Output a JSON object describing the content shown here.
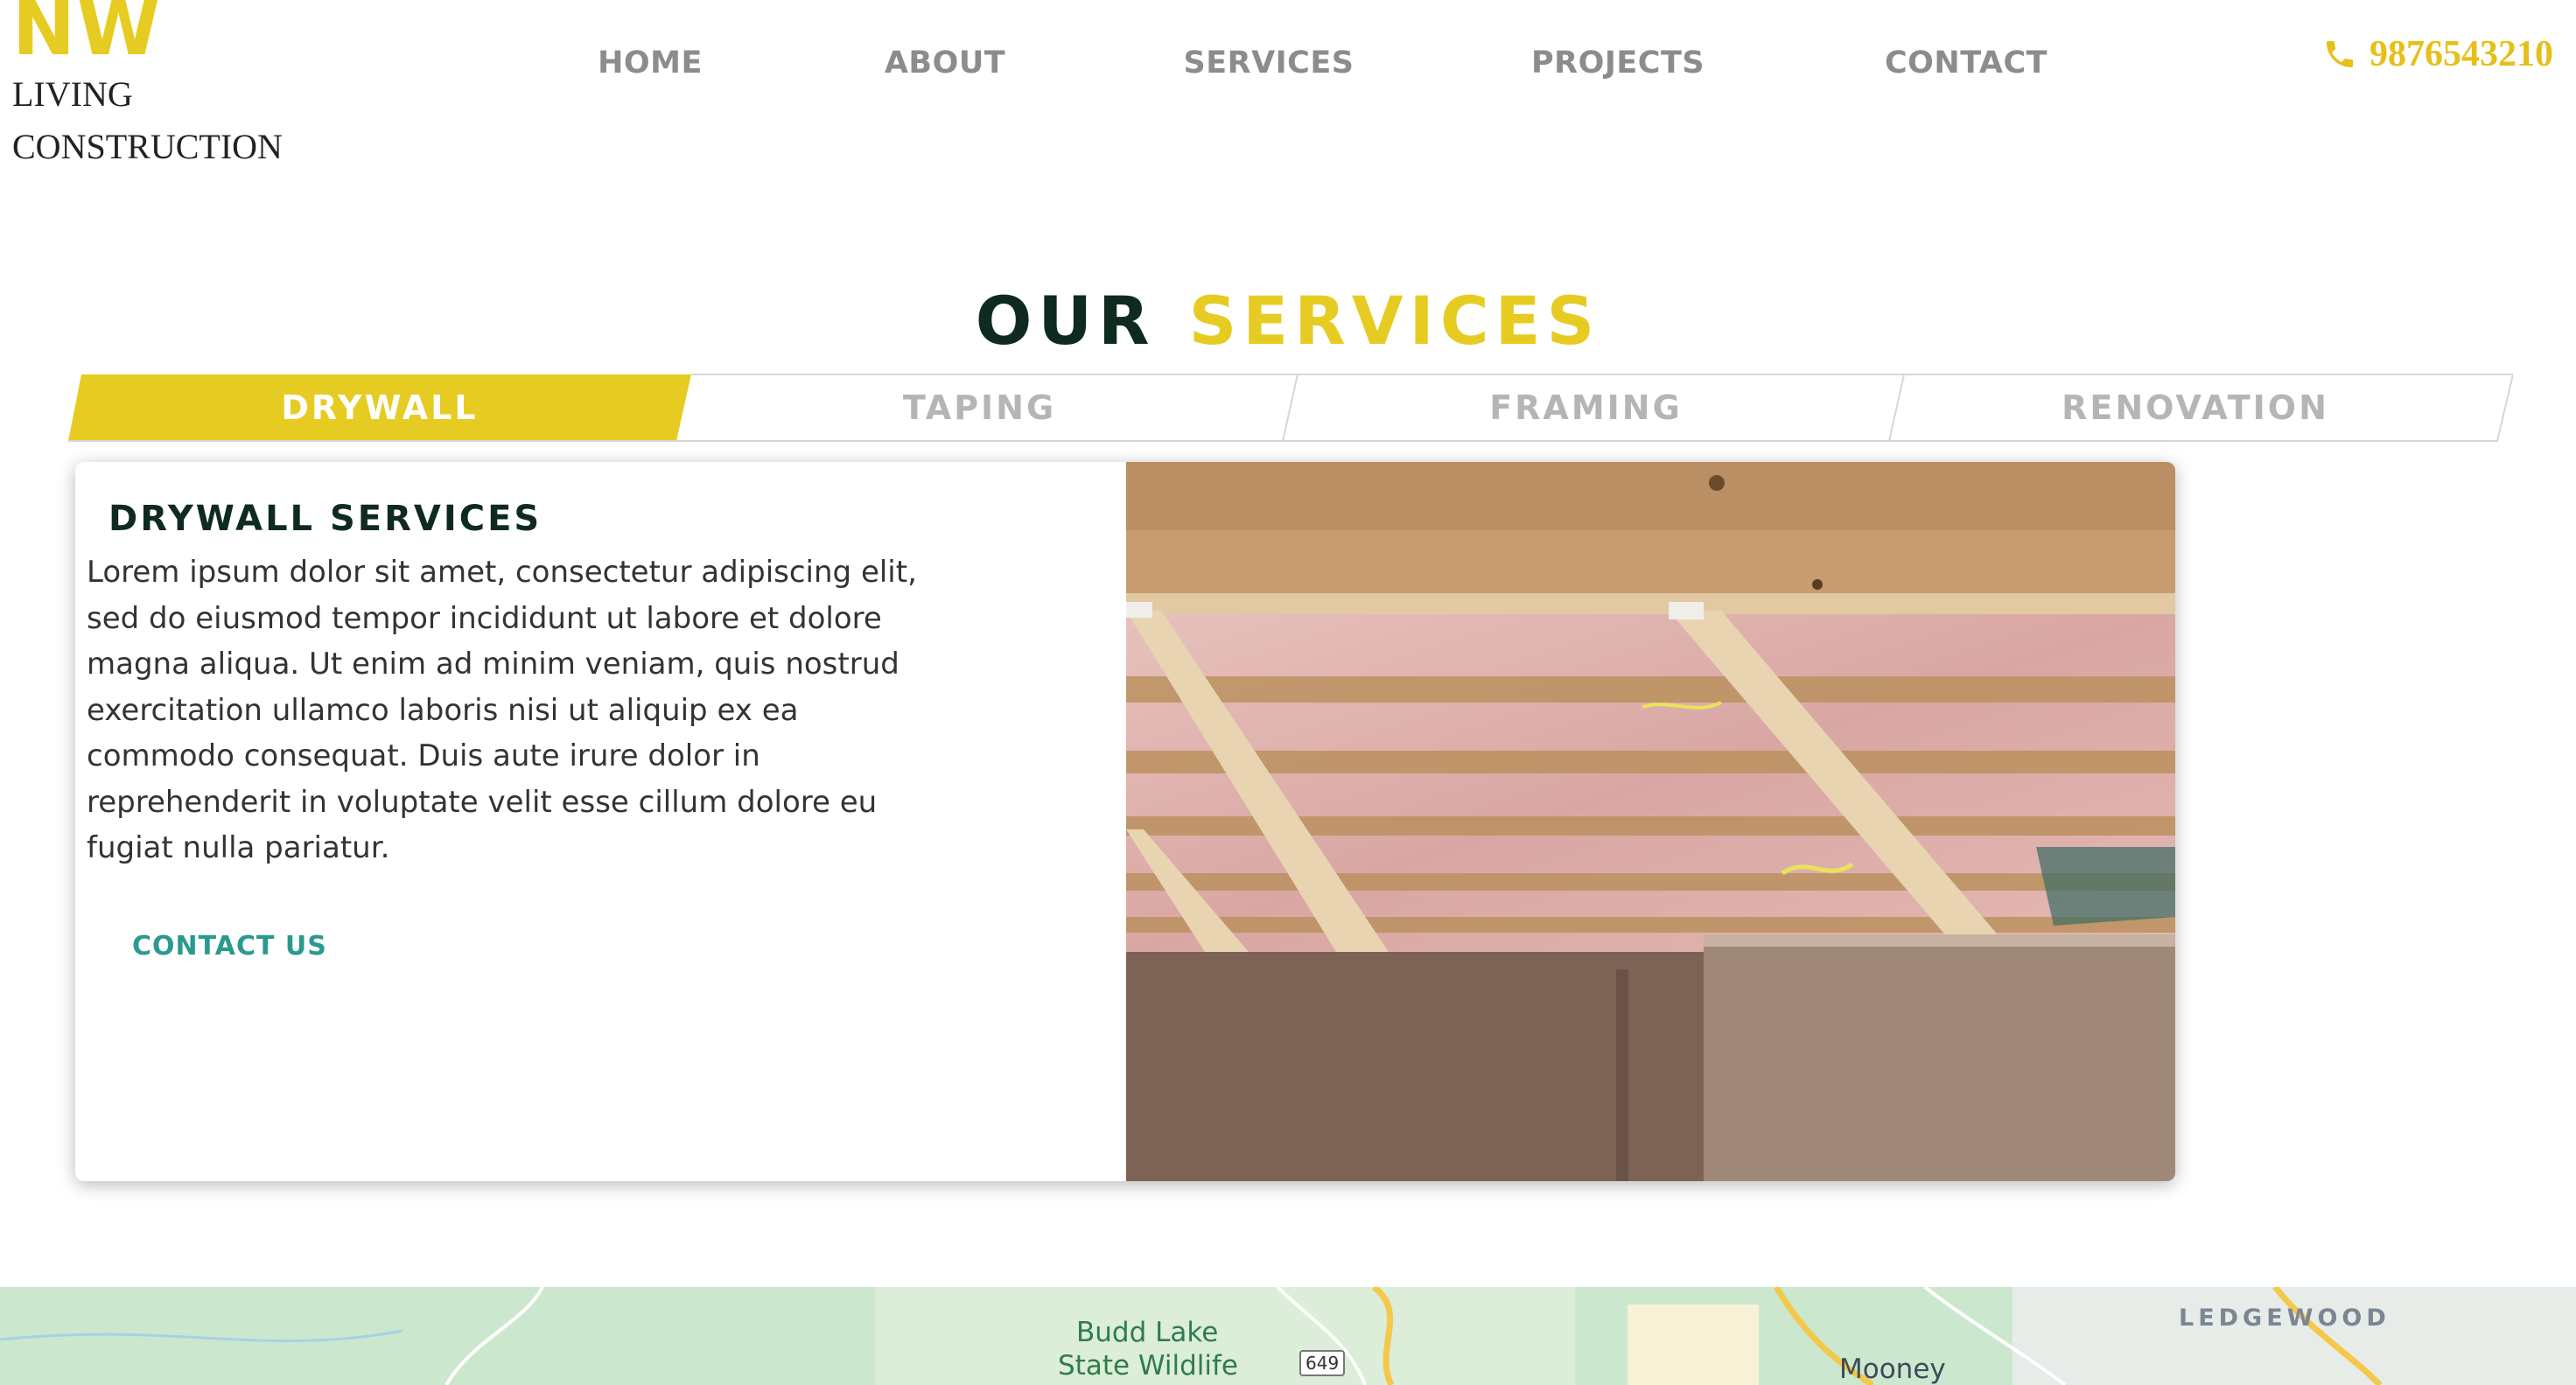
{
  "logo": {
    "nw": "NW",
    "line1": "LIVING",
    "line2": "CONSTRUCTION"
  },
  "nav": {
    "items": [
      "HOME",
      "ABOUT",
      "SERVICES",
      "PROJECTS",
      "CONTACT"
    ]
  },
  "phone": {
    "icon": "phone-icon",
    "number": "9876543210"
  },
  "services": {
    "title_dark": "OUR",
    "title_accent": "SERVICES",
    "tabs": [
      {
        "label": "DRYWALL",
        "active": true
      },
      {
        "label": "TAPING",
        "active": false
      },
      {
        "label": "FRAMING",
        "active": false
      },
      {
        "label": "RENOVATION",
        "active": false
      }
    ],
    "card": {
      "heading": "DRYWALL SERVICES",
      "body": "Lorem ipsum dolor sit amet, consectetur adipiscing elit, sed do eiusmod tempor incididunt ut labore et dolore magna aliqua. Ut enim ad minim veniam, quis nostrud exercitation ullamco laboris nisi ut aliquip ex ea commodo consequat. Duis aute irure dolor in reprehenderit in voluptate velit esse cillum dolore eu fugiat nulla pariatur.",
      "link": "CONTACT US"
    }
  },
  "map": {
    "park_line1": "Budd Lake",
    "park_line2": "State Wildlife",
    "route": "649",
    "town1": "Mooney",
    "town2": "LEDGEWOOD"
  },
  "colors": {
    "accent": "#e6cc22",
    "dark": "#0f2b1f",
    "nav": "#8c8c8c",
    "link": "#2a9a8d",
    "map_green": "#cbe8cf"
  }
}
